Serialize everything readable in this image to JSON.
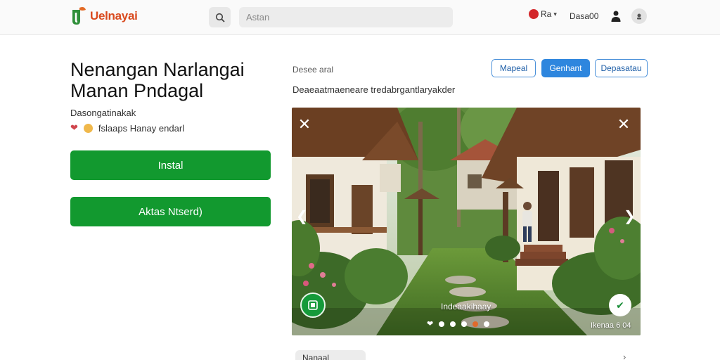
{
  "header": {
    "brand": "Uelnayai",
    "search_placeholder": "Astan",
    "user_label": "Ra",
    "sign_label": "Dasa00"
  },
  "app": {
    "title": "Nenangan Narlangai Manan Pndagal",
    "developer": "Dasongatinakak",
    "rating_text": "fslaaps Hanay endarl",
    "install_label": "Instal",
    "secondary_label": "Aktas Ntserd)"
  },
  "details": {
    "section_label": "Desee aral",
    "pills": [
      "Mapeal",
      "Genhant",
      "Depasatau"
    ],
    "description": "Deaeaatmaeneare tredabrgantlaryakder"
  },
  "gallery": {
    "caption": "Indeaakihaay",
    "counter": "Ikenaa 6 04",
    "active_dot": 4
  },
  "footer": {
    "chip_label": "Nanaal"
  },
  "colors": {
    "brand": "#d94a1e",
    "install_green": "#12992f",
    "pill_blue": "#2e86de",
    "notification_red": "#d3272b"
  },
  "icons": [
    "logo-icon",
    "search-icon",
    "notification-icon",
    "caret-down-icon",
    "person-icon",
    "avatar-icon",
    "heart-icon",
    "emoji-icon",
    "close-icon",
    "chevron-left-icon",
    "chevron-right-icon",
    "badge-icon",
    "check-icon",
    "arrow-right-icon"
  ]
}
